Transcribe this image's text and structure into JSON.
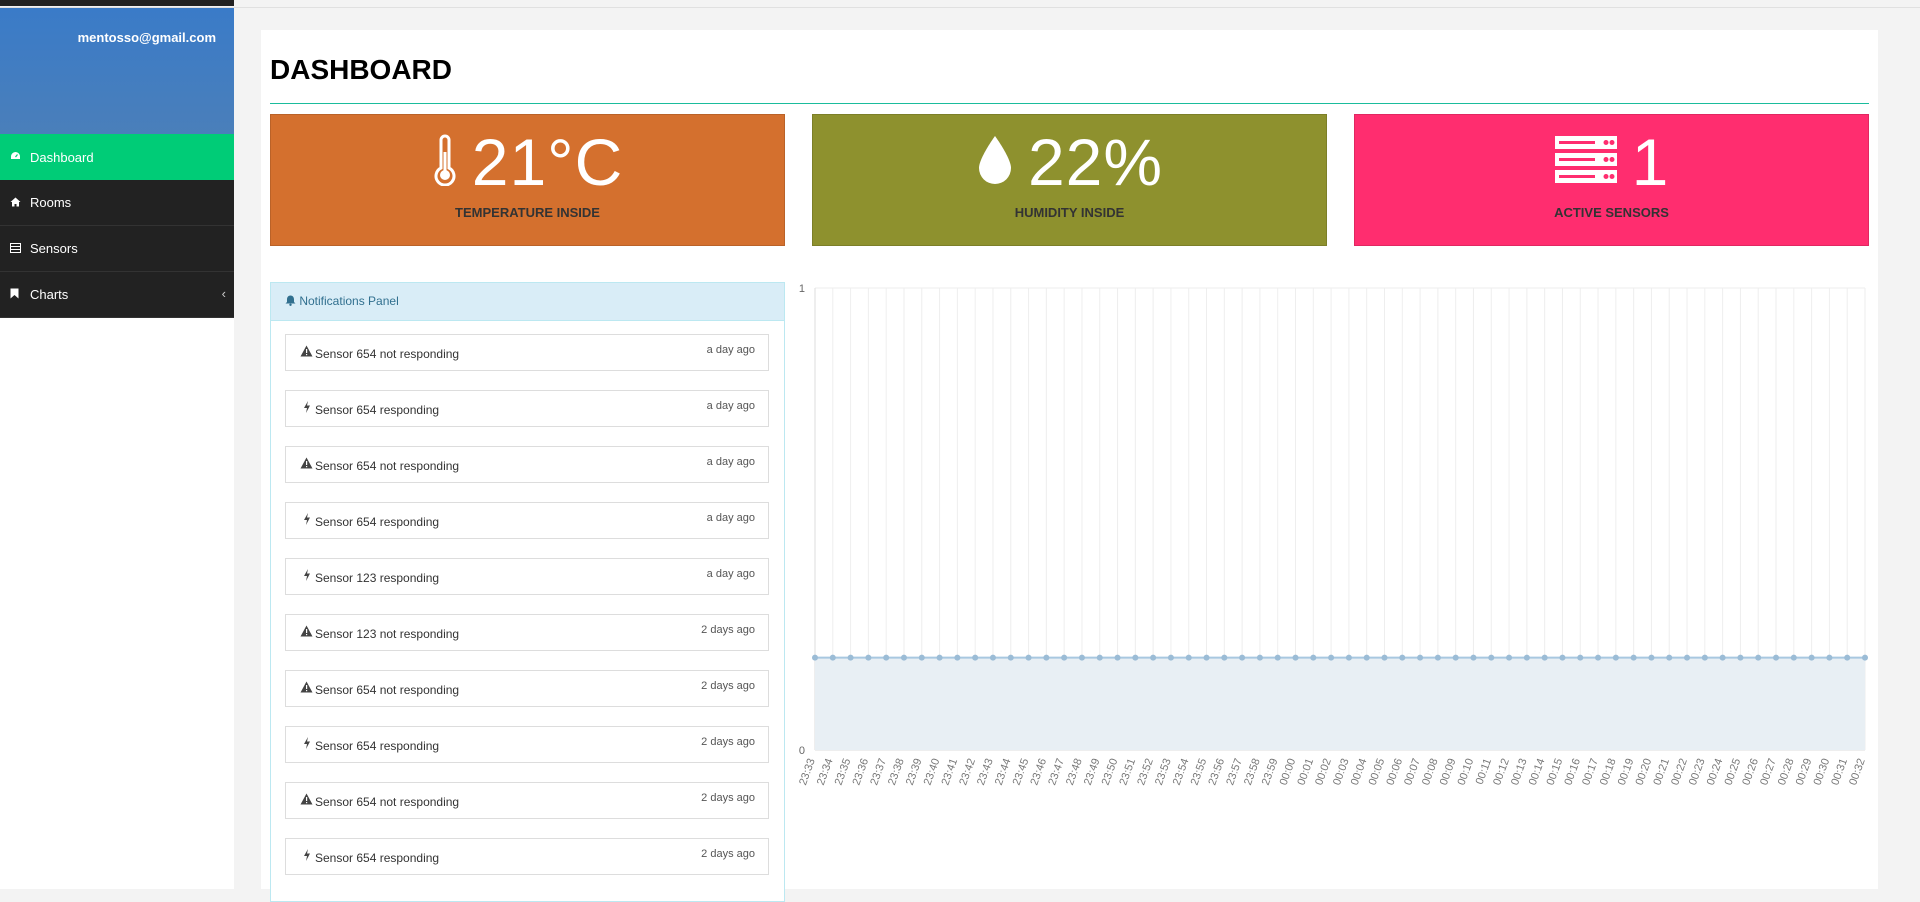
{
  "user": {
    "email": "mentosso@gmail.com"
  },
  "nav": [
    {
      "label": "Dashboard",
      "icon": "dashboard-icon",
      "active": true
    },
    {
      "label": "Rooms",
      "icon": "home-icon"
    },
    {
      "label": "Sensors",
      "icon": "list-icon"
    },
    {
      "label": "Charts",
      "icon": "bookmark-icon",
      "arrow": "‹"
    }
  ],
  "page": {
    "title": "DASHBOARD"
  },
  "stats": [
    {
      "value": "21°C",
      "label": "TEMPERATURE INSIDE",
      "icon": "thermometer-icon",
      "color": "#d4702e"
    },
    {
      "value": "22%",
      "label": "HUMIDITY INSIDE",
      "icon": "droplet-icon",
      "color": "#8e912e"
    },
    {
      "value": "1",
      "label": "ACTIVE SENSORS",
      "icon": "server-icon",
      "color": "#ff2d6f"
    }
  ],
  "notifications": {
    "title": "Notifications Panel",
    "items": [
      {
        "type": "warning",
        "text": "Sensor 654 not responding",
        "time": "a day ago"
      },
      {
        "type": "bolt",
        "text": "Sensor 654 responding",
        "time": "a day ago"
      },
      {
        "type": "warning",
        "text": "Sensor 654 not responding",
        "time": "a day ago"
      },
      {
        "type": "bolt",
        "text": "Sensor 654 responding",
        "time": "a day ago"
      },
      {
        "type": "bolt",
        "text": "Sensor 123 responding",
        "time": "a day ago"
      },
      {
        "type": "warning",
        "text": "Sensor 123 not responding",
        "time": "2 days ago"
      },
      {
        "type": "warning",
        "text": "Sensor 654 not responding",
        "time": "2 days ago"
      },
      {
        "type": "bolt",
        "text": "Sensor 654 responding",
        "time": "2 days ago"
      },
      {
        "type": "warning",
        "text": "Sensor 654 not responding",
        "time": "2 days ago"
      },
      {
        "type": "bolt",
        "text": "Sensor 654 responding",
        "time": "2 days ago"
      }
    ]
  },
  "chart_data": {
    "type": "area",
    "ylim": [
      0,
      1
    ],
    "yticks": [
      "0",
      "1"
    ],
    "categories": [
      "23:33",
      "23:34",
      "23:35",
      "23:36",
      "23:37",
      "23:38",
      "23:39",
      "23:40",
      "23:41",
      "23:42",
      "23:43",
      "23:44",
      "23:45",
      "23:46",
      "23:47",
      "23:48",
      "23:49",
      "23:50",
      "23:51",
      "23:52",
      "23:53",
      "23:54",
      "23:55",
      "23:56",
      "23:57",
      "23:58",
      "23:59",
      "00:00",
      "00:01",
      "00:02",
      "00:03",
      "00:04",
      "00:05",
      "00:06",
      "00:07",
      "00:08",
      "00:09",
      "00:10",
      "00:11",
      "00:12",
      "00:13",
      "00:14",
      "00:15",
      "00:16",
      "00:17",
      "00:18",
      "00:19",
      "00:20",
      "00:21",
      "00:22",
      "00:23",
      "00:24",
      "00:25",
      "00:26",
      "00:27",
      "00:28",
      "00:29",
      "00:30",
      "00:31",
      "00:32"
    ],
    "series": [
      {
        "values": [
          0.2,
          0.2,
          0.2,
          0.2,
          0.2,
          0.2,
          0.2,
          0.2,
          0.2,
          0.2,
          0.2,
          0.2,
          0.2,
          0.2,
          0.2,
          0.2,
          0.2,
          0.2,
          0.2,
          0.2,
          0.2,
          0.2,
          0.2,
          0.2,
          0.2,
          0.2,
          0.2,
          0.2,
          0.2,
          0.2,
          0.2,
          0.2,
          0.2,
          0.2,
          0.2,
          0.2,
          0.2,
          0.2,
          0.2,
          0.2,
          0.2,
          0.2,
          0.2,
          0.2,
          0.2,
          0.2,
          0.2,
          0.2,
          0.2,
          0.2,
          0.2,
          0.2,
          0.2,
          0.2,
          0.2,
          0.2,
          0.2,
          0.2,
          0.2,
          0.2
        ],
        "count": 60
      }
    ],
    "grid": true,
    "colors": {
      "line": "#a8c8e0",
      "fill": "#e8eff4",
      "point": "#9bbcd6",
      "grid": "#eeeeee"
    }
  }
}
